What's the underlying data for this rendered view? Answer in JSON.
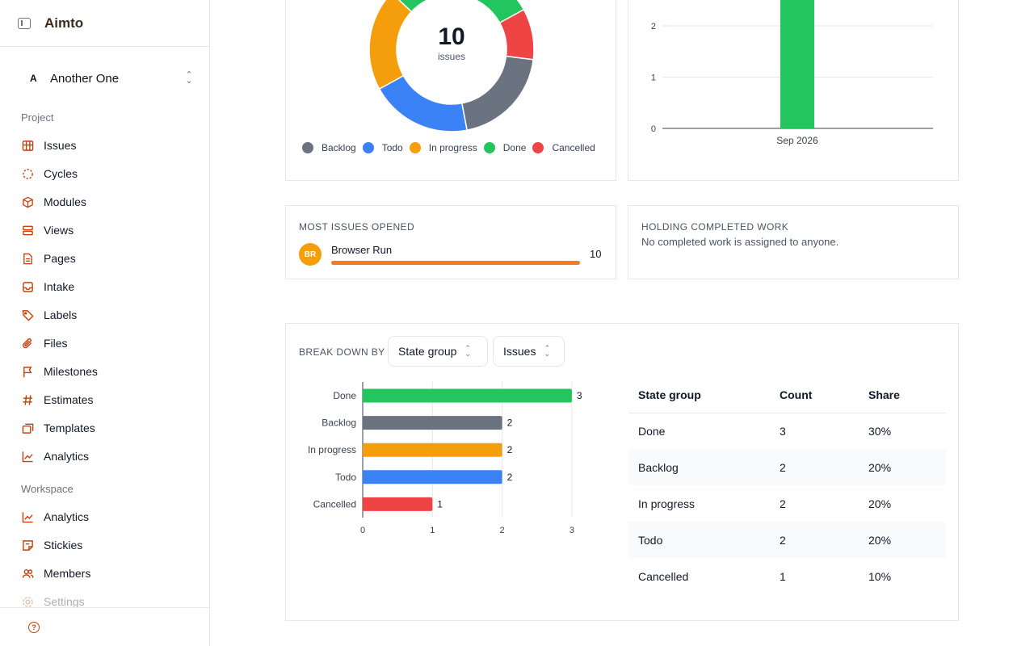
{
  "sidebar": {
    "brand": "Aimto",
    "workspace_letter": "A",
    "workspace_name": "Another One",
    "project_label": "Project",
    "project_items": [
      {
        "label": "Issues",
        "icon": "issues-icon"
      },
      {
        "label": "Cycles",
        "icon": "cycles-icon"
      },
      {
        "label": "Modules",
        "icon": "modules-icon"
      },
      {
        "label": "Views",
        "icon": "views-icon"
      },
      {
        "label": "Pages",
        "icon": "pages-icon"
      },
      {
        "label": "Intake",
        "icon": "intake-icon"
      },
      {
        "label": "Labels",
        "icon": "labels-icon"
      },
      {
        "label": "Files",
        "icon": "files-icon"
      },
      {
        "label": "Milestones",
        "icon": "milestones-icon"
      },
      {
        "label": "Estimates",
        "icon": "estimates-icon"
      },
      {
        "label": "Templates",
        "icon": "templates-icon"
      },
      {
        "label": "Analytics",
        "icon": "analytics-icon"
      }
    ],
    "workspace_label": "Workspace",
    "workspace_items": [
      {
        "label": "Analytics",
        "icon": "analytics-icon"
      },
      {
        "label": "Stickies",
        "icon": "stickies-icon"
      },
      {
        "label": "Members",
        "icon": "members-icon"
      },
      {
        "label": "Settings",
        "icon": "settings-icon"
      }
    ],
    "help_glyph": "?"
  },
  "donut": {
    "total": "10",
    "total_label": "issues",
    "legend": [
      {
        "label": "Backlog",
        "color": "#6b7280"
      },
      {
        "label": "Todo",
        "color": "#3b82f6"
      },
      {
        "label": "In progress",
        "color": "#f59e0b"
      },
      {
        "label": "Done",
        "color": "#22c55e"
      },
      {
        "label": "Cancelled",
        "color": "#ef4444"
      }
    ]
  },
  "most_opened": {
    "title": "MOST ISSUES OPENED",
    "initials": "BR",
    "name": "Browser Run",
    "count": "10"
  },
  "holding": {
    "title": "HOLDING COMPLETED WORK",
    "message": "No completed work is assigned to anyone."
  },
  "breakdown": {
    "label": "BREAK DOWN BY",
    "group_select": "State group",
    "metric_select": "Issues",
    "table_headers": [
      "State group",
      "Count",
      "Share"
    ],
    "rows": [
      [
        "Done",
        "3",
        "30%"
      ],
      [
        "Backlog",
        "2",
        "20%"
      ],
      [
        "In progress",
        "2",
        "20%"
      ],
      [
        "Todo",
        "2",
        "20%"
      ],
      [
        "Cancelled",
        "1",
        "10%"
      ]
    ]
  },
  "chart_data": [
    {
      "type": "pie",
      "style": "donut",
      "center_value": "10",
      "center_label": "issues",
      "categories": [
        "Backlog",
        "Todo",
        "In progress",
        "Done",
        "Cancelled"
      ],
      "values": [
        2,
        2,
        2,
        3,
        1
      ],
      "colors": [
        "#6b7280",
        "#3b82f6",
        "#f59e0b",
        "#22c55e",
        "#ef4444"
      ],
      "legend": "bottom"
    },
    {
      "type": "bar",
      "categories": [
        "Sep 2026"
      ],
      "values": [
        3
      ],
      "yticks": [
        0,
        1,
        2
      ],
      "ylim": [
        0,
        3
      ],
      "color": "#22c55e",
      "grid": true
    },
    {
      "type": "bar",
      "orientation": "horizontal",
      "categories": [
        "Done",
        "Backlog",
        "In progress",
        "Todo",
        "Cancelled"
      ],
      "values": [
        3,
        2,
        2,
        2,
        1
      ],
      "colors": [
        "#22c55e",
        "#6b7280",
        "#f59e0b",
        "#3b82f6",
        "#ef4444"
      ],
      "xticks": [
        0,
        1,
        2,
        3
      ],
      "xlim": [
        0,
        3
      ],
      "data_labels": true,
      "grid": true
    }
  ]
}
